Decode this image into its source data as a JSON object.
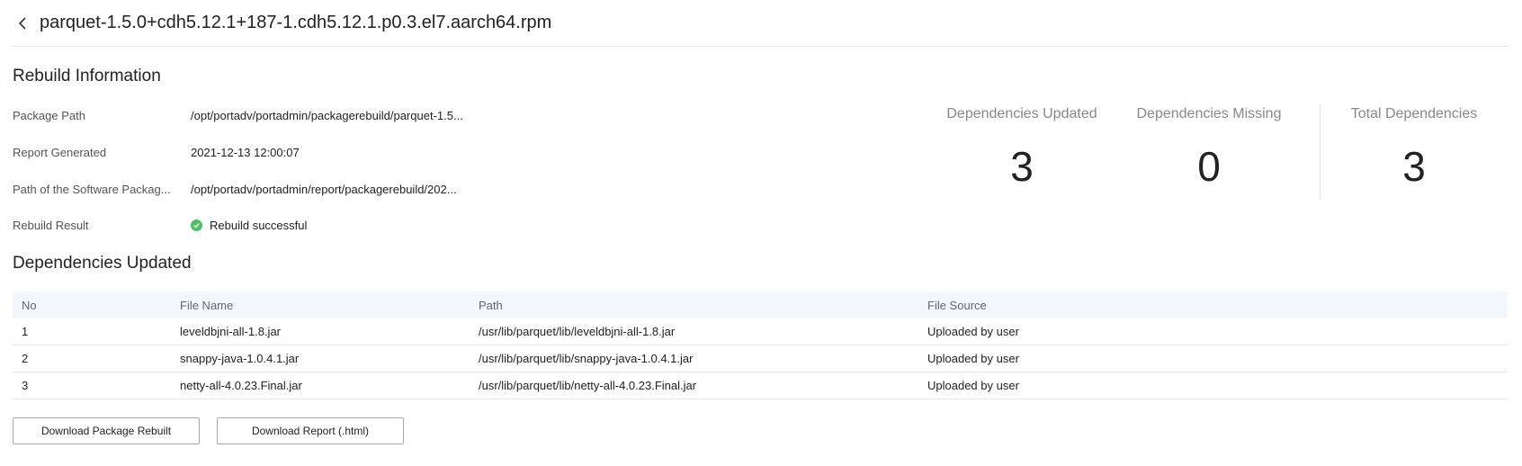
{
  "header": {
    "title": "parquet-1.5.0+cdh5.12.1+187-1.cdh5.12.1.p0.3.el7.aarch64.rpm"
  },
  "rebuild_info": {
    "title": "Rebuild Information",
    "rows": [
      {
        "label": "Package Path",
        "value": "/opt/portadv/portadmin/packagerebuild/parquet-1.5..."
      },
      {
        "label": "Report Generated",
        "value": "2021-12-13 12:00:07"
      },
      {
        "label": "Path of the Software Packag...",
        "value": "/opt/portadv/portadmin/report/packagerebuild/202..."
      },
      {
        "label": "Rebuild Result",
        "value": "Rebuild successful"
      }
    ],
    "result_status_color": "#4fbf67"
  },
  "stats": [
    {
      "label": "Dependencies Updated",
      "value": "3"
    },
    {
      "label": "Dependencies Missing",
      "value": "0"
    },
    {
      "label": "Total Dependencies",
      "value": "3"
    }
  ],
  "dependencies": {
    "title": "Dependencies Updated",
    "columns": [
      "No",
      "File Name",
      "Path",
      "File Source"
    ],
    "rows": [
      {
        "no": "1",
        "file": "leveldbjni-all-1.8.jar",
        "path": "/usr/lib/parquet/lib/leveldbjni-all-1.8.jar",
        "source": "Uploaded by user"
      },
      {
        "no": "2",
        "file": "snappy-java-1.0.4.1.jar",
        "path": "/usr/lib/parquet/lib/snappy-java-1.0.4.1.jar",
        "source": "Uploaded by user"
      },
      {
        "no": "3",
        "file": "netty-all-4.0.23.Final.jar",
        "path": "/usr/lib/parquet/lib/netty-all-4.0.23.Final.jar",
        "source": "Uploaded by user"
      }
    ]
  },
  "actions": {
    "download_package": "Download Package Rebuilt",
    "download_report": "Download Report (.html)"
  },
  "icons": {
    "back": "chevron-left-icon",
    "success": "check-circle-icon"
  }
}
